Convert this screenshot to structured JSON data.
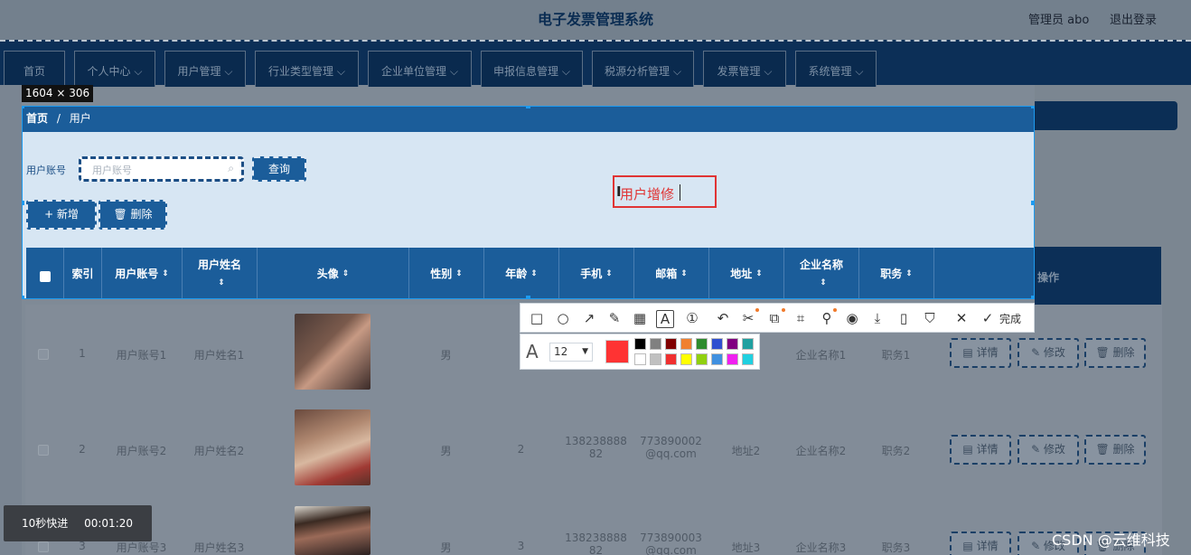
{
  "app": {
    "title": "电子发票管理系统",
    "admin": "管理员 abo",
    "logout": "退出登录"
  },
  "nav": [
    {
      "label": "首页"
    },
    {
      "label": "个人中心 ⌵"
    },
    {
      "label": "用户管理 ⌵"
    },
    {
      "label": "行业类型管理 ⌵"
    },
    {
      "label": "企业单位管理 ⌵"
    },
    {
      "label": "申报信息管理 ⌵"
    },
    {
      "label": "税源分析管理 ⌵"
    },
    {
      "label": "发票管理 ⌵"
    },
    {
      "label": "系统管理 ⌵"
    }
  ],
  "selection": {
    "size_label": "1604 × 306"
  },
  "breadcrumb": {
    "home": "首页",
    "sep": "/",
    "current": "用户"
  },
  "search": {
    "label": "用户账号",
    "placeholder": "用户账号",
    "query_button": "查询"
  },
  "actions": {
    "add": "+ 新增",
    "delete": "🗑 删除"
  },
  "annotation": {
    "text": "用户增修",
    "ibeam": "I"
  },
  "table": {
    "headers": {
      "index": "索引",
      "account": "用户账号",
      "name": "用户姓名",
      "avatar": "头像",
      "gender": "性别",
      "age": "年龄",
      "phone": "手机",
      "email": "邮箱",
      "address": "地址",
      "company": "企业名称",
      "position": "职务",
      "operation": "操作"
    },
    "sort_glyph": "⇕",
    "rows": [
      {
        "index": "1",
        "account": "用户账号1",
        "name": "用户姓名1",
        "gender": "男",
        "age": "",
        "phone1": "",
        "phone2": "",
        "email1": "",
        "email2": "",
        "address": "",
        "company": "企业名称1",
        "position": "职务1"
      },
      {
        "index": "2",
        "account": "用户账号2",
        "name": "用户姓名2",
        "gender": "男",
        "age": "2",
        "phone1": "138238888",
        "phone2": "82",
        "email1": "773890002",
        "email2": "@qq.com",
        "address": "地址2",
        "company": "企业名称2",
        "position": "职务2"
      },
      {
        "index": "3",
        "account": "用户账号3",
        "name": "用户姓名3",
        "gender": "男",
        "age": "3",
        "phone1": "138238888",
        "phone2": "82",
        "email1": "773890003",
        "email2": "@qq.com",
        "address": "地址3",
        "company": "企业名称3",
        "position": "职务3"
      }
    ],
    "row_buttons": {
      "detail": "▤ 详情",
      "edit": "✎ 修改",
      "delete": "🗑 删除"
    }
  },
  "toolbar": {
    "tools": [
      {
        "icon": "rectangle-icon",
        "glyph": "□"
      },
      {
        "icon": "ellipse-icon",
        "glyph": "○"
      },
      {
        "icon": "arrow-icon",
        "glyph": "↗"
      },
      {
        "icon": "pencil-icon",
        "glyph": "✎"
      },
      {
        "icon": "mosaic-icon",
        "glyph": "▦"
      },
      {
        "icon": "text-icon",
        "glyph": "A"
      },
      {
        "icon": "number-icon",
        "glyph": "①"
      },
      {
        "icon": "undo-icon",
        "glyph": "↶"
      },
      {
        "icon": "scissors-icon",
        "glyph": "✂"
      },
      {
        "icon": "translate-icon",
        "glyph": "⧉"
      },
      {
        "icon": "ocr-icon",
        "glyph": "⌗"
      },
      {
        "icon": "pin-icon",
        "glyph": "⚲"
      },
      {
        "icon": "record-icon",
        "glyph": "◉"
      },
      {
        "icon": "download-icon",
        "glyph": "⤓"
      },
      {
        "icon": "phone-icon",
        "glyph": "▯"
      },
      {
        "icon": "bookmark-icon",
        "glyph": "⛉"
      },
      {
        "icon": "close-icon",
        "glyph": "✕"
      },
      {
        "icon": "check-icon",
        "glyph": "✓"
      }
    ],
    "done": "完成",
    "font_glyph": "A",
    "font_size": "12",
    "current_color": "#ff3333",
    "palette": [
      "#000000",
      "#808080",
      "#800000",
      "#f08030",
      "#2e8b2e",
      "#3050d0",
      "#800080",
      "#20a0a0",
      "#ffffff",
      "#c0c0c0",
      "#f03030",
      "#ffff00",
      "#90d010",
      "#4090e0",
      "#f020f0",
      "#20d0e0"
    ]
  },
  "video": {
    "label": "10秒快进",
    "time": "00:01:20"
  },
  "watermark": "CSDN @云维科技"
}
